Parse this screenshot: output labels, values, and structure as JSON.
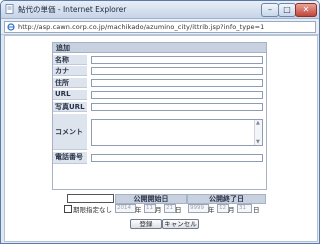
{
  "window": {
    "title": "鮎代の単価 - Internet Explorer",
    "controls": {
      "minimize": "–",
      "maximize": "□",
      "close": "✕"
    }
  },
  "address": {
    "url": "http://asp.cawn.corp.co.jp/machikado/azumino_city/ittrib.jsp?info_type=1"
  },
  "form": {
    "section_title": "追加",
    "fields": [
      {
        "label": "名称",
        "value": ""
      },
      {
        "label": "カナ",
        "value": ""
      },
      {
        "label": "住所",
        "value": ""
      },
      {
        "label": "URL",
        "value": ""
      },
      {
        "label": "写真URL",
        "value": ""
      }
    ],
    "comment_label": "コメント",
    "comment_value": "",
    "phone_label": "電話番号",
    "phone_value": ""
  },
  "period": {
    "blank_value": "",
    "start_header": "公開開始日",
    "end_header": "公開終了日",
    "unlimited_label": "期限指定なし",
    "start": {
      "year_ph": "2014",
      "year_unit": "年",
      "month_ph": "11",
      "month_unit": "月",
      "day_ph": "21",
      "day_unit": "日"
    },
    "end": {
      "year_ph": "9999",
      "year_unit": "年",
      "month_ph": "12",
      "month_unit": "月",
      "day_ph": "31",
      "day_unit": "日"
    }
  },
  "buttons": {
    "submit": "登録",
    "cancel": "キャンセル"
  },
  "icons": {
    "app": "page-icon",
    "ie": "ie-icon"
  },
  "colors": {
    "title_gradient_top": "#e8eef6",
    "close_red": "#c0463a",
    "header_bg": "#c7d1df"
  }
}
